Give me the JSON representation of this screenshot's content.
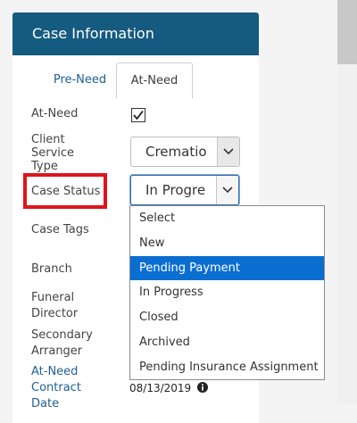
{
  "card": {
    "title": "Case Information"
  },
  "tabs": [
    {
      "label": "Pre-Need",
      "active": false
    },
    {
      "label": "At-Need",
      "active": true
    }
  ],
  "fields": {
    "at_need": {
      "label": "At-Need",
      "checked": true
    },
    "client_service_type": {
      "label": "Client Service Type",
      "label_lines": [
        "Client",
        "Service",
        "Type"
      ],
      "value": "Crematio"
    },
    "case_status": {
      "label": "Case Status",
      "value": "In Progre"
    },
    "case_tags": {
      "label": "Case Tags"
    },
    "branch": {
      "label": "Branch"
    },
    "funeral_director": {
      "label_lines": [
        "Funeral",
        "Director"
      ]
    },
    "secondary_arranger": {
      "label_lines": [
        "Secondary",
        "Arranger"
      ]
    },
    "at_need_contract_date": {
      "label_lines": [
        "At-Need",
        "Contract",
        "Date"
      ],
      "value": "08/13/2019"
    }
  },
  "dropdown": {
    "options": [
      "Select",
      "New",
      "Pending Payment",
      "In Progress",
      "Closed",
      "Archived",
      "Pending Insurance Assignment"
    ],
    "highlighted": "Pending Payment"
  },
  "colors": {
    "header_bg": "#155a7f",
    "link": "#1f5f8f",
    "selected_option_bg": "#0a6ed1",
    "annotation_border": "#e0141a"
  },
  "icons": {
    "checkbox": "checkmark-icon",
    "select_button": "chevron-down-icon",
    "info": "info-circle-icon"
  }
}
